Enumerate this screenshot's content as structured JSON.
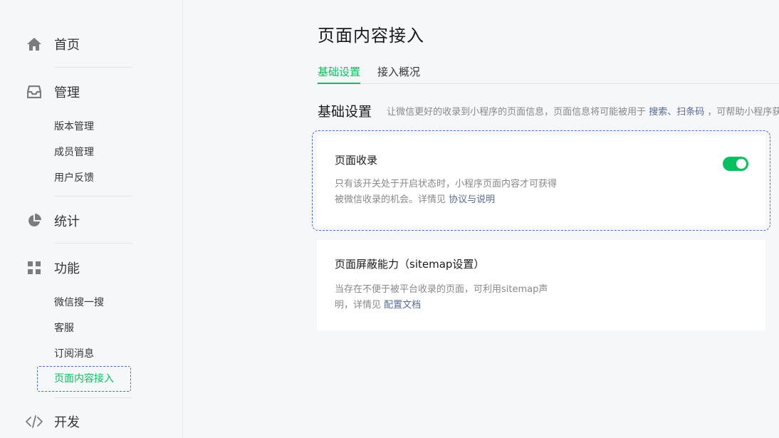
{
  "sidebar": {
    "home": {
      "label": "首页",
      "icon": "home-icon"
    },
    "manage": {
      "label": "管理",
      "icon": "inbox-icon",
      "items": [
        "版本管理",
        "成员管理",
        "用户反馈"
      ]
    },
    "stats": {
      "label": "统计",
      "icon": "pie-chart-icon"
    },
    "features": {
      "label": "功能",
      "icon": "grid-icon",
      "items": [
        "微信搜一搜",
        "客服",
        "订阅消息",
        "页面内容接入"
      ],
      "active_index": 3
    },
    "dev": {
      "label": "开发",
      "icon": "code-icon"
    }
  },
  "main": {
    "title": "页面内容接入",
    "tabs": [
      {
        "label": "基础设置",
        "active": true
      },
      {
        "label": "接入概况",
        "active": false
      }
    ],
    "section": {
      "title": "基础设置",
      "desc_prefix": "让微信更好的收录到小程序的页面信息，页面信息将可能被用于",
      "desc_link": "搜索、扫条码",
      "desc_suffix": "，可帮助小程序获得更多曝光"
    },
    "cards": [
      {
        "title": "页面收录",
        "desc_line1": "只有该开关处于开启状态时，小程序页面内容才可获得",
        "desc_line2": "被微信收录的机会。详情见",
        "link": "协议与说明",
        "toggle_on": true
      },
      {
        "title": "页面屏蔽能力（sitemap设置）",
        "desc_line1": "当存在不便于被平台收录的页面，可利用sitemap声",
        "desc_line2": "明，详情见",
        "link": "配置文档"
      }
    ]
  },
  "colors": {
    "accent": "#07c160",
    "link": "#576b95",
    "focus": "#4a6ad5"
  }
}
